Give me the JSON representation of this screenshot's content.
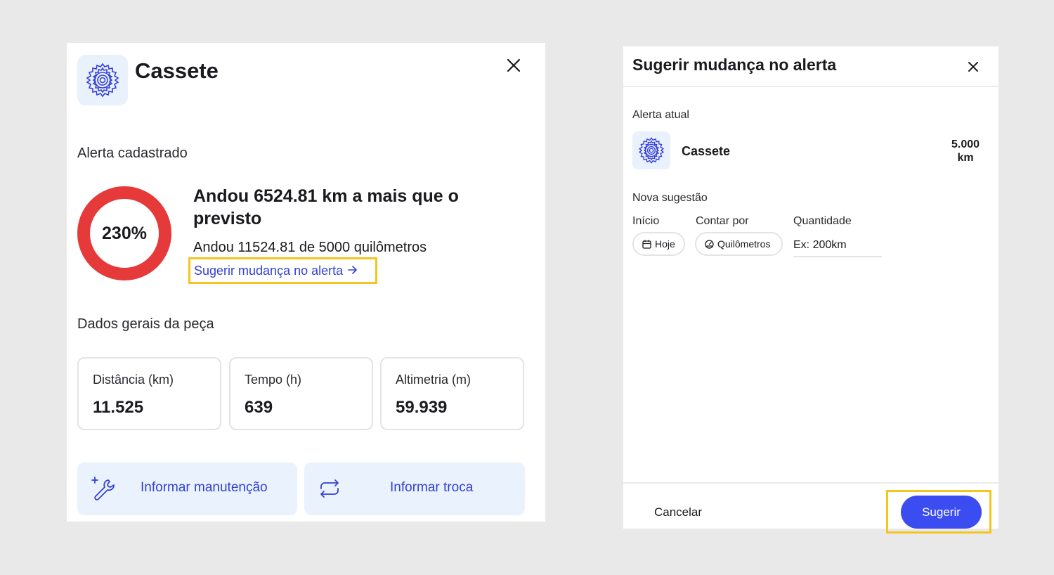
{
  "colors": {
    "accent": "#3b4cf0",
    "link": "#3340d6",
    "ring": "#e63939",
    "highlight": "#f4c51f",
    "icon_bg": "#e9f1fc"
  },
  "part_detail": {
    "icon": "cassette-gear-icon",
    "title": "Cassete",
    "close_icon": "close-icon",
    "alert_section_label": "Alerta cadastrado",
    "alert": {
      "percent_label": "230%",
      "percent_value": 230,
      "headline": "Andou 6524.81 km a mais que o previsto",
      "subline": "Andou 11524.81 de 5000 quilômetros",
      "suggest_link": "Sugerir mudança no alerta",
      "suggest_link_icon": "arrow-right-icon"
    },
    "general_section_label": "Dados gerais da peça",
    "stats": [
      {
        "label": "Distância (km)",
        "value": "11.525"
      },
      {
        "label": "Tempo (h)",
        "value": "639"
      },
      {
        "label": "Altimetria (m)",
        "value": "59.939"
      }
    ],
    "actions": [
      {
        "label": "Informar manutenção",
        "icon": "wrench-plus-icon"
      },
      {
        "label": "Informar troca",
        "icon": "swap-cycle-icon"
      }
    ]
  },
  "suggest_dialog": {
    "title": "Sugerir mudança no alerta",
    "close_icon": "close-icon",
    "current_label": "Alerta atual",
    "current": {
      "icon": "cassette-gear-icon",
      "name": "Cassete",
      "value": "5.000",
      "unit": "km"
    },
    "new_label": "Nova sugestão",
    "fields": {
      "start_label": "Início",
      "start_value": "Hoje",
      "start_icon": "calendar-icon",
      "count_label": "Contar por",
      "count_value": "Quilômetros",
      "count_icon": "speedometer-icon",
      "quantity_label": "Quantidade",
      "quantity_placeholder": "Ex: 200km"
    },
    "cancel_label": "Cancelar",
    "submit_label": "Sugerir"
  }
}
